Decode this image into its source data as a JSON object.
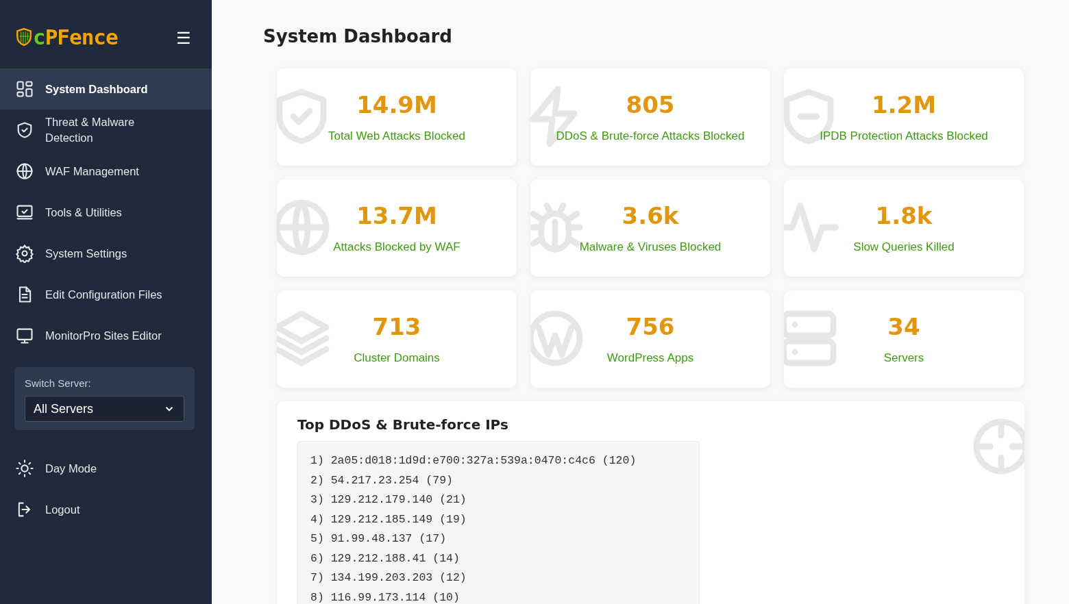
{
  "logo": "cPFence",
  "menu_button": "☰",
  "nav": [
    {
      "label": "System Dashboard",
      "kind": "grid",
      "selected": true
    },
    {
      "label": "Threat & Malware Detection",
      "kind": "shield",
      "selected": false
    },
    {
      "label": "WAF Management",
      "kind": "globe",
      "selected": false
    },
    {
      "label": "Tools & Utilities",
      "kind": "monitor-check",
      "selected": false
    },
    {
      "label": "System Settings",
      "kind": "gear",
      "selected": false
    },
    {
      "label": "Edit Configuration Files",
      "kind": "file",
      "selected": false
    },
    {
      "label": "MonitorPro Sites Editor",
      "kind": "monitor",
      "selected": false
    }
  ],
  "switch_server": {
    "label": "Switch Server:",
    "value": "All Servers"
  },
  "bottom_nav": [
    {
      "label": "Day Mode",
      "kind": "sun"
    },
    {
      "label": "Logout",
      "kind": "logout"
    }
  ],
  "page_title": "System Dashboard",
  "stats": [
    {
      "value": "14.9M",
      "label": "Total Web Attacks Blocked",
      "kind": "shield-check"
    },
    {
      "value": "805",
      "label": "DDoS & Brute-force Attacks Blocked",
      "kind": "bolt"
    },
    {
      "value": "1.2M",
      "label": "IPDB Protection Attacks Blocked",
      "kind": "shield-minus"
    },
    {
      "value": "13.7M",
      "label": "Attacks Blocked by WAF",
      "kind": "globe"
    },
    {
      "value": "3.6k",
      "label": "Malware & Viruses Blocked",
      "kind": "bug"
    },
    {
      "value": "1.8k",
      "label": "Slow Queries Killed",
      "kind": "pulse"
    },
    {
      "value": "713",
      "label": "Cluster Domains",
      "kind": "layers"
    },
    {
      "value": "756",
      "label": "WordPress Apps",
      "kind": "wordpress"
    },
    {
      "value": "34",
      "label": "Servers",
      "kind": "server"
    }
  ],
  "top_ips": {
    "title": "Top DDoS & Brute-force IPs",
    "lines": [
      "1) 2a05:d018:1d9d:e700:327a:539a:0470:c4c6 (120)",
      "2) 54.217.23.254 (79)",
      "3) 129.212.179.140 (21)",
      "4) 129.212.185.149 (19)",
      "5) 91.99.48.137 (17)",
      "6) 129.212.188.41 (14)",
      "7) 134.199.203.203 (12)",
      "8) 116.99.173.114 (10)"
    ]
  }
}
